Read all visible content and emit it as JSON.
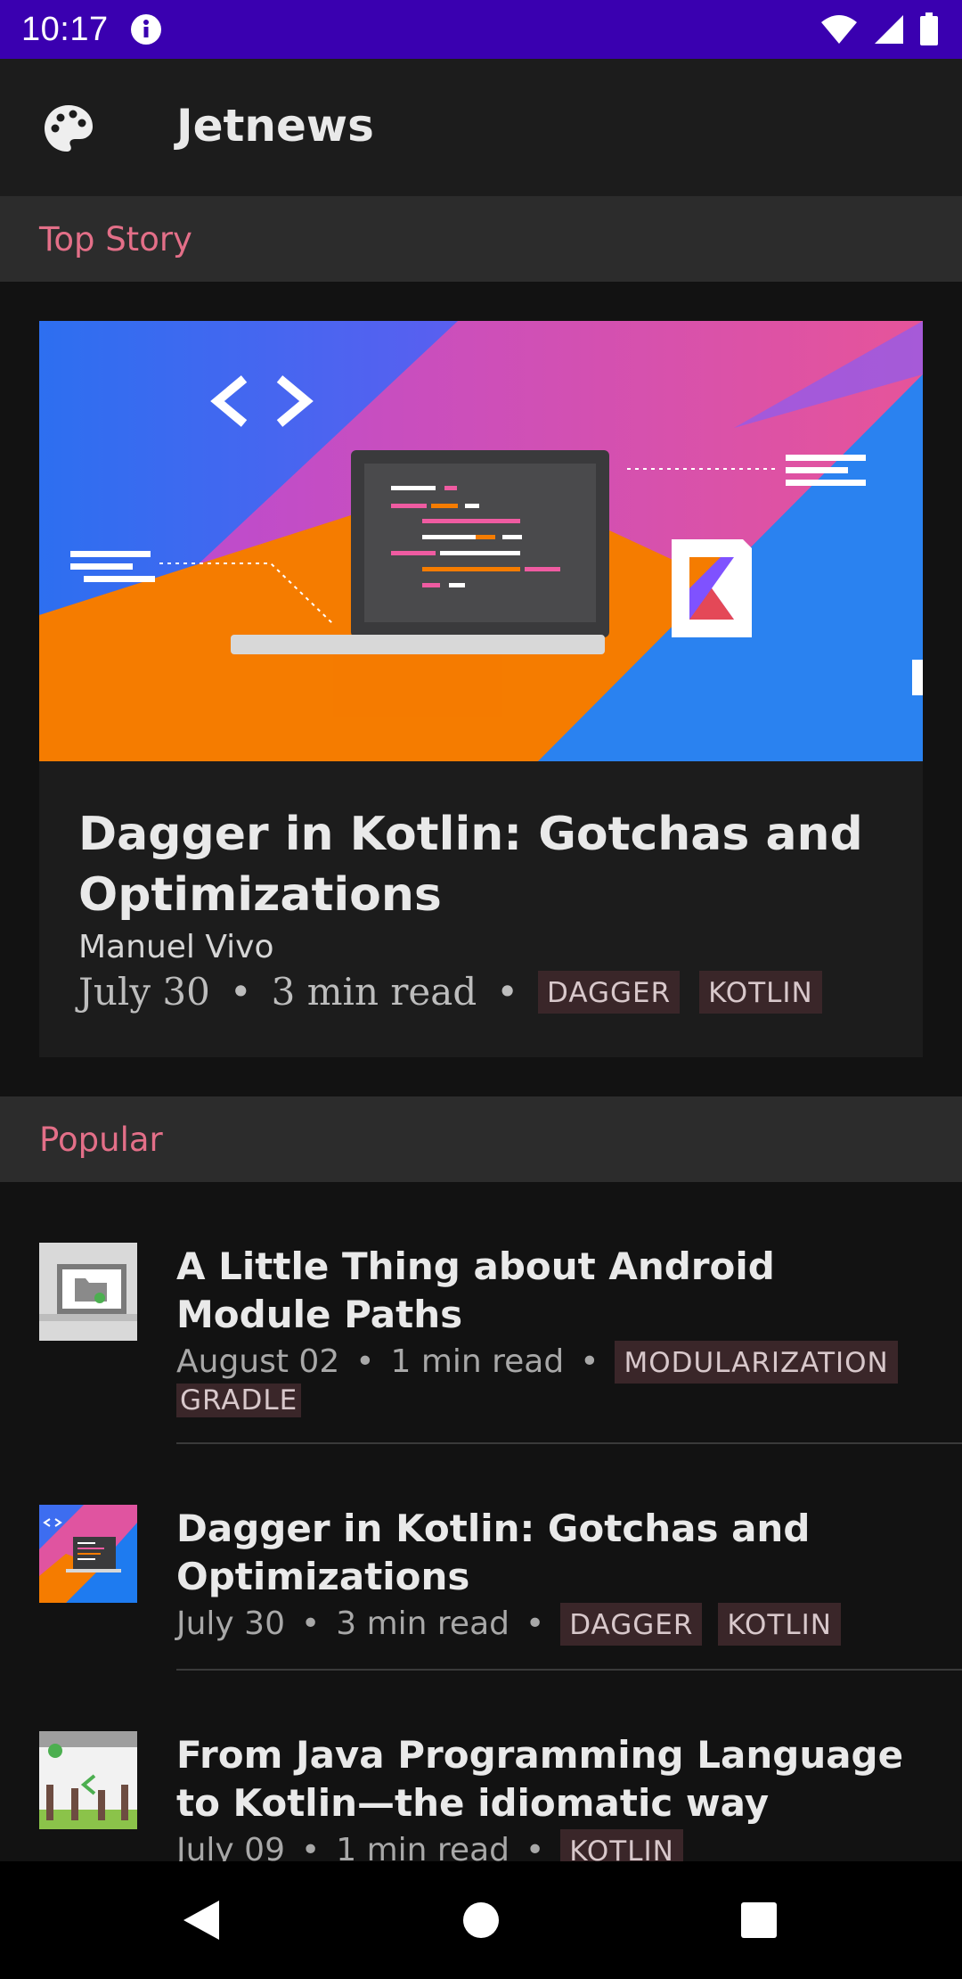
{
  "status_bar": {
    "time": "10:17"
  },
  "app_bar": {
    "title": "Jetnews"
  },
  "sections": {
    "top_story": "Top Story",
    "popular": "Popular"
  },
  "top_story": {
    "title": "Dagger in Kotlin: Gotchas and Optimizations",
    "author": "Manuel Vivo",
    "date": "July 30",
    "read_time": "3 min read",
    "separator": "•",
    "tags": [
      "DAGGER",
      "KOTLIN"
    ]
  },
  "popular": [
    {
      "title": "A Little Thing about Android Module Paths",
      "date": "August 02",
      "read_time": "1 min read",
      "tags": [
        "MODULARIZATION",
        "GRADLE"
      ]
    },
    {
      "title": "Dagger in Kotlin: Gotchas and Optimizations",
      "date": "July 30",
      "read_time": "3 min read",
      "tags": [
        "DAGGER",
        "KOTLIN"
      ]
    },
    {
      "title": "From Java Programming Language to Kotlin—the idiomatic way",
      "date": "July 09",
      "read_time": "1 min read",
      "tags": [
        "KOTLIN"
      ]
    }
  ],
  "colors": {
    "status_bar": "#3a00b0",
    "section_label": "#e36f88",
    "tag_bg": "#3a2629"
  }
}
